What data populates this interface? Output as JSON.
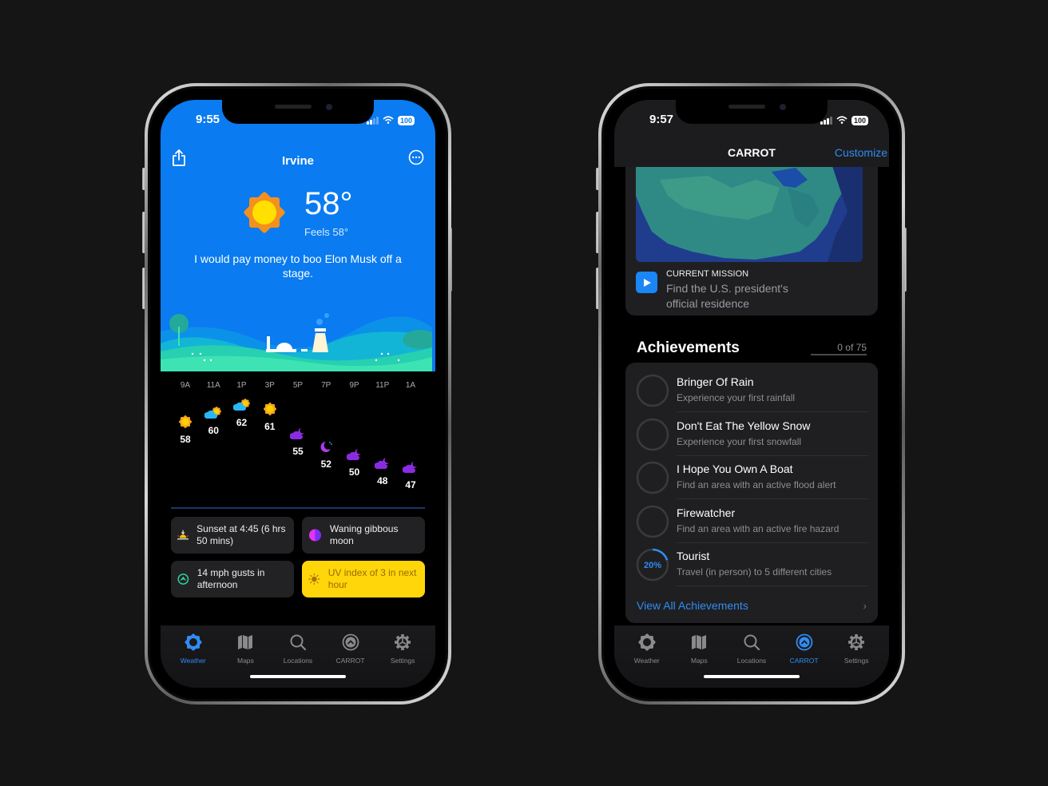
{
  "left_phone": {
    "status": {
      "time": "9:55",
      "battery": "100"
    },
    "header": {
      "city": "Irvine",
      "share_icon": "share-icon",
      "more_icon": "ellipsis-circle-icon"
    },
    "current": {
      "icon": "sun-icon",
      "temperature": "58°",
      "feels_like": "Feels 58°",
      "quote": "I would pay money to boo Elon Musk off a stage."
    },
    "hourly": [
      {
        "time": "9A",
        "temp": "58",
        "icon": "sun"
      },
      {
        "time": "11A",
        "temp": "60",
        "icon": "partly-cloudy-day"
      },
      {
        "time": "1P",
        "temp": "62",
        "icon": "partly-cloudy-day"
      },
      {
        "time": "3P",
        "temp": "61",
        "icon": "sun"
      },
      {
        "time": "5P",
        "temp": "55",
        "icon": "cloudy-night"
      },
      {
        "time": "7P",
        "temp": "52",
        "icon": "clear-night"
      },
      {
        "time": "9P",
        "temp": "50",
        "icon": "cloudy-night"
      },
      {
        "time": "11P",
        "temp": "48",
        "icon": "cloudy-night"
      },
      {
        "time": "1A",
        "temp": "47",
        "icon": "cloudy-night"
      }
    ],
    "cards": [
      {
        "icon": "sunset-icon",
        "text": "Sunset at 4:45 (6 hrs 50 mins)"
      },
      {
        "icon": "moon-phase-icon",
        "text": "Waning gibbous moon"
      },
      {
        "icon": "wind-icon",
        "text": "14 mph gusts in afternoon"
      },
      {
        "icon": "uv-icon",
        "text": "UV index of 3 in next hour"
      }
    ],
    "tabs": [
      {
        "label": "Weather",
        "icon": "weather-tab-icon",
        "active": true
      },
      {
        "label": "Maps",
        "icon": "map-icon",
        "active": false
      },
      {
        "label": "Locations",
        "icon": "search-icon",
        "active": false
      },
      {
        "label": "CARROT",
        "icon": "carrot-icon",
        "active": false
      },
      {
        "label": "Settings",
        "icon": "gear-icon",
        "active": false
      }
    ]
  },
  "right_phone": {
    "status": {
      "time": "9:57",
      "battery": "100"
    },
    "nav": {
      "title": "CARROT",
      "action": "Customize"
    },
    "mission": {
      "kicker": "CURRENT MISSION",
      "text": "Find the U.S. president's official residence"
    },
    "achievements": {
      "title": "Achievements",
      "count": "0 of 75",
      "items": [
        {
          "name": "Bringer Of Rain",
          "desc": "Experience your first rainfall",
          "progress": 0
        },
        {
          "name": "Don't Eat The Yellow Snow",
          "desc": "Experience your first snowfall",
          "progress": 0
        },
        {
          "name": "I Hope You Own A Boat",
          "desc": "Find an area with an active flood alert",
          "progress": 0
        },
        {
          "name": "Firewatcher",
          "desc": "Find an area with an active fire hazard",
          "progress": 0
        },
        {
          "name": "Tourist",
          "desc": "Travel (in person) to 5 different cities",
          "progress": 20,
          "progress_label": "20%"
        }
      ],
      "view_all": "View All Achievements"
    },
    "tabs": [
      {
        "label": "Weather",
        "icon": "weather-tab-icon",
        "active": false
      },
      {
        "label": "Maps",
        "icon": "map-icon",
        "active": false
      },
      {
        "label": "Locations",
        "icon": "search-icon",
        "active": false
      },
      {
        "label": "CARROT",
        "icon": "carrot-icon",
        "active": true
      },
      {
        "label": "Settings",
        "icon": "gear-icon",
        "active": false
      }
    ]
  },
  "colors": {
    "accent": "#2f8cf3",
    "weather_bg": "#0a7bf0",
    "uv_card": "#ffd60a",
    "night_icon": "#8a2be2",
    "cloud_day": "#29b6f6",
    "sun": "#ffc107"
  }
}
